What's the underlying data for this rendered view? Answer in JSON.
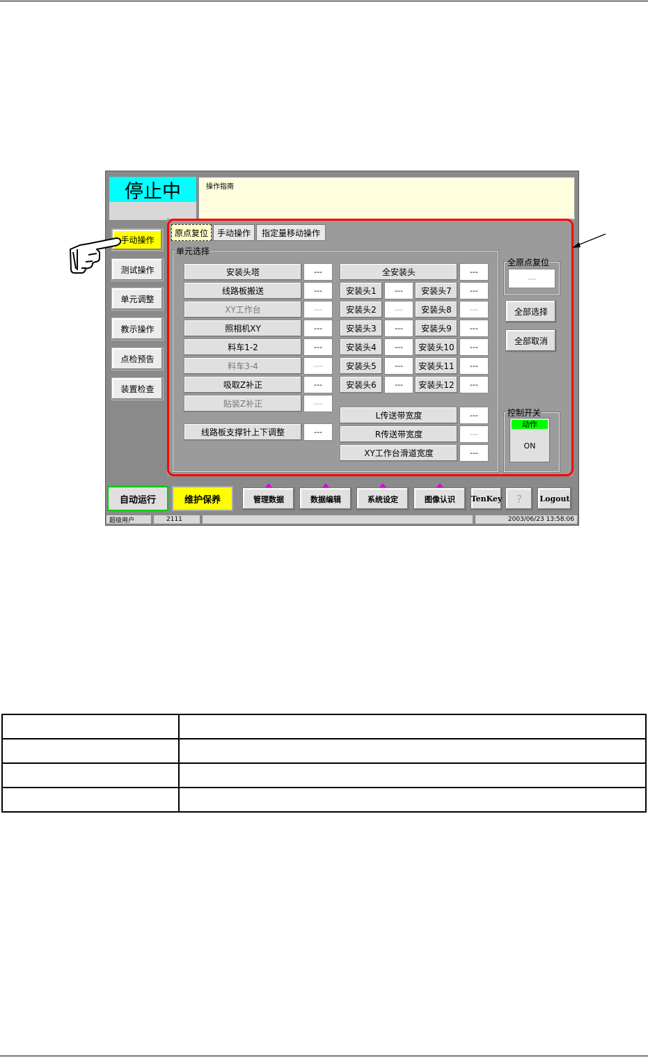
{
  "status_text": "停止中",
  "guide_label": "操作指南",
  "left_menu": [
    "手动操作",
    "测试操作",
    "单元调整",
    "教示操作",
    "点检预告",
    "装置检查"
  ],
  "tabs": [
    "原点复位",
    "手动操作",
    "指定量移动操作"
  ],
  "unit_select_label": "单元选择",
  "units_left": [
    {
      "label": "安装头塔",
      "value": "---"
    },
    {
      "label": "线路板搬送",
      "value": "---"
    },
    {
      "label": "XY工作台",
      "value": "---"
    },
    {
      "label": "照相机XY",
      "value": "---"
    },
    {
      "label": "料车1-2",
      "value": "---"
    },
    {
      "label": "料车3-4",
      "value": "---"
    },
    {
      "label": "吸取Z补正",
      "value": "---"
    },
    {
      "label": "贴装Z补正",
      "value": "---"
    }
  ],
  "pcb_support": {
    "label": "线路板支撑针上下调整",
    "value": "---"
  },
  "all_heads": {
    "label": "全安装头",
    "value": "---"
  },
  "heads_col1": [
    {
      "label": "安装头1",
      "value": "---"
    },
    {
      "label": "安装头2",
      "value": "---"
    },
    {
      "label": "安装头3",
      "value": "---"
    },
    {
      "label": "安装头4",
      "value": "---"
    },
    {
      "label": "安装头5",
      "value": "---"
    },
    {
      "label": "安装头6",
      "value": "---"
    }
  ],
  "heads_col2": [
    {
      "label": "安装头7",
      "value": "---"
    },
    {
      "label": "安装头8",
      "value": "---"
    },
    {
      "label": "安装头9",
      "value": "---"
    },
    {
      "label": "安装头10",
      "value": "---"
    },
    {
      "label": "安装头11",
      "value": "---"
    },
    {
      "label": "安装头12",
      "value": "---"
    }
  ],
  "widths": [
    {
      "label": "L传送带宽度",
      "value": "---"
    },
    {
      "label": "R传送带宽度",
      "value": "---"
    },
    {
      "label": "XY工作台滑道宽度",
      "value": "---"
    }
  ],
  "all_home": {
    "label": "全原点复位",
    "value": "---"
  },
  "select_all": "全部选择",
  "cancel_all": "全部取消",
  "control_switch": {
    "label": "控制开关",
    "action": "动作",
    "state": "ON"
  },
  "bottom_bar": {
    "auto_run": "自动运行",
    "maintenance": "维护保养",
    "buttons": [
      "管理数据",
      "数据编辑",
      "系统设定",
      "图像认识"
    ],
    "tenkey": "TenKey",
    "help": "?",
    "logout": "Logout"
  },
  "status_bar": {
    "user": "超级用户",
    "code": "2111",
    "datetime": "2003/06/23 13:58:06"
  },
  "colors": {
    "status_bg": "#00ffff",
    "active_yellow": "#ffff00",
    "highlight_red": "#ff0000",
    "green_border": "#00cc00"
  }
}
